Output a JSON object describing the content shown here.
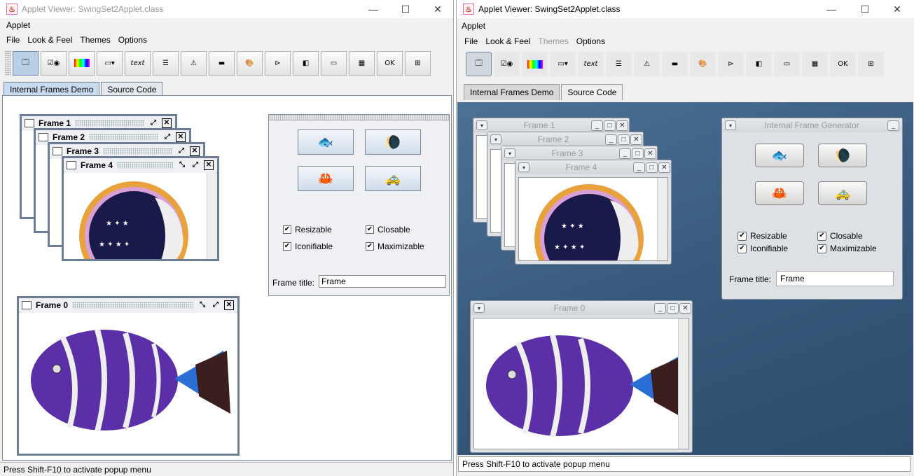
{
  "left_window": {
    "title": "Applet Viewer: SwingSet2Applet.class",
    "applet_menu": "Applet",
    "menus": [
      "File",
      "Look & Feel",
      "Themes",
      "Options"
    ],
    "tabs": [
      "Internal Frames Demo",
      "Source Code"
    ],
    "frames": [
      "Frame 1",
      "Frame 2",
      "Frame 3",
      "Frame 4",
      "Frame 0"
    ],
    "checkboxes": [
      "Resizable",
      "Closable",
      "Iconifiable",
      "Maximizable"
    ],
    "frame_title_label": "Frame title:",
    "frame_title_value": "Frame",
    "status": "Press Shift-F10 to activate popup menu"
  },
  "right_window": {
    "title": "Applet Viewer: SwingSet2Applet.class",
    "applet_menu": "Applet",
    "menus": [
      "File",
      "Look & Feel",
      "Themes",
      "Options"
    ],
    "tabs": [
      "Internal Frames Demo",
      "Source Code"
    ],
    "generator_title": "Internal Frame Generator",
    "frames": [
      "Frame 1",
      "Frame 2",
      "Frame 3",
      "Frame 4",
      "Frame 0"
    ],
    "checkboxes": [
      "Resizable",
      "Closable",
      "Iconifiable",
      "Maximizable"
    ],
    "frame_title_label": "Frame title:",
    "frame_title_value": "Frame",
    "status": "Press Shift-F10 to activate popup menu"
  },
  "toolbar_icons": [
    "internal-frame-icon",
    "checkbox-radio-icon",
    "color-chooser-icon",
    "combobox-icon",
    "text-icon",
    "list-icon",
    "option-pane-icon",
    "progress-bar-icon",
    "image-icon",
    "slider-icon",
    "split-pane-icon",
    "tabbed-pane-icon",
    "table-icon",
    "tooltip-icon",
    "tree-icon"
  ],
  "toolbar_text": {
    "text_icon": "text",
    "tooltip_icon": "OK"
  },
  "colors": {
    "desktop_metal": "#ffffff",
    "desktop_nimbus": "#3d5f80",
    "metal_frame_border": "#6b7e95"
  }
}
